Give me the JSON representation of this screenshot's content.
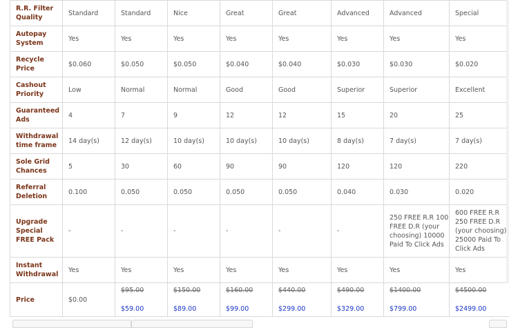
{
  "columns": [
    "R.R. Filter Quality",
    "Standard",
    "Standard",
    "Nice",
    "Great",
    "Great",
    "Advanced",
    "Advanced",
    "Special"
  ],
  "rows": [
    {
      "label": "Autopay System",
      "cells": [
        "Yes",
        "Yes",
        "Yes",
        "Yes",
        "Yes",
        "Yes",
        "Yes",
        "Yes"
      ]
    },
    {
      "label": "Recycle Price",
      "cells": [
        "$0.060",
        "$0.050",
        "$0.050",
        "$0.040",
        "$0.040",
        "$0.030",
        "$0.030",
        "$0.020"
      ]
    },
    {
      "label": "Cashout Priority",
      "cells": [
        "Low",
        "Normal",
        "Normal",
        "Good",
        "Good",
        "Superior",
        "Superior",
        "Excellent"
      ]
    },
    {
      "label": "Guaranteed Ads",
      "cells": [
        "4",
        "7",
        "9",
        "12",
        "12",
        "15",
        "20",
        "25"
      ]
    },
    {
      "label": "Withdrawal time frame",
      "cells": [
        "14 day(s)",
        "12 day(s)",
        "10 day(s)",
        "10 day(s)",
        "10 day(s)",
        "8 day(s)",
        "7 day(s)",
        "7 day(s)"
      ]
    },
    {
      "label": "Sole Grid Chances",
      "cells": [
        "5",
        "30",
        "60",
        "90",
        "90",
        "120",
        "120",
        "220"
      ]
    },
    {
      "label": "Referral Deletion",
      "cells": [
        "0.100",
        "0.050",
        "0.050",
        "0.050",
        "0.050",
        "0.040",
        "0.030",
        "0.020"
      ]
    },
    {
      "label": "Upgrade Special FREE Pack",
      "cells": [
        "-",
        "-",
        "-",
        "-",
        "-",
        "-",
        "250 FREE R.R 100 FREE D.R (your choosing) 10000 Paid To Click Ads",
        "600 FREE R.R 250 FREE D.R (your choosing) 25000 Paid To Click Ads"
      ]
    },
    {
      "label": "Instant Withdrawal",
      "cells": [
        "Yes",
        "Yes",
        "Yes",
        "Yes",
        "Yes",
        "Yes",
        "Yes",
        "Yes"
      ]
    }
  ],
  "price_row": {
    "label": "Price",
    "first": "$0.00",
    "prices": [
      {
        "old": "$95.00",
        "new": "$59.00"
      },
      {
        "old": "$150.00",
        "new": "$89.00"
      },
      {
        "old": "$160.00",
        "new": "$99.00"
      },
      {
        "old": "$440.00",
        "new": "$299.00"
      },
      {
        "old": "$490.00",
        "new": "$329.00"
      },
      {
        "old": "$1400.00",
        "new": "$799.00"
      },
      {
        "old": "$4500.00",
        "new": "$2499.00"
      }
    ]
  }
}
